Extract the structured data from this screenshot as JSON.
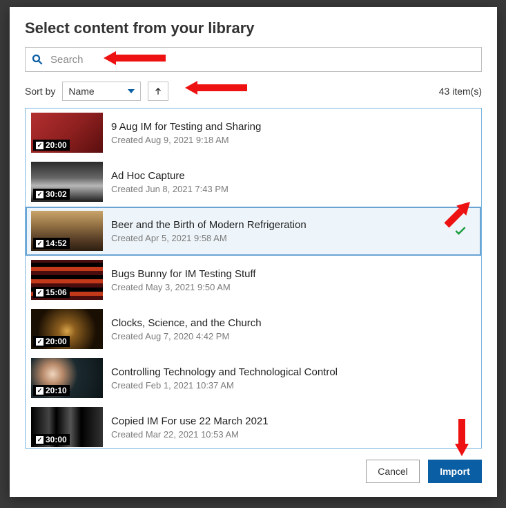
{
  "dialog": {
    "title": "Select content from your library",
    "search_placeholder": "Search",
    "sort_label": "Sort by",
    "sort_value": "Name",
    "item_count": "43 item(s)",
    "cancel_label": "Cancel",
    "import_label": "Import"
  },
  "items": [
    {
      "title": "9 Aug IM for Testing and Sharing",
      "subtitle": "Created Aug 9, 2021 9:18 AM",
      "duration": "20:00",
      "selected": false,
      "thumb_css": "linear-gradient(135deg,#b42f2f 0%,#8c1f1f 55%,#5a0e0e 100%)"
    },
    {
      "title": "Ad Hoc Capture",
      "subtitle": "Created Jun 8, 2021 7:43 PM",
      "duration": "30:02",
      "selected": false,
      "thumb_css": "linear-gradient(180deg,#2b2b2b 0%,#666 40%,#b7b7b7 60%,#1e1e1e 100%)"
    },
    {
      "title": "Beer and the Birth of Modern Refrigeration",
      "subtitle": "Created Apr 5, 2021 9:58 AM",
      "duration": "14:52",
      "selected": true,
      "thumb_css": "linear-gradient(180deg,#c9a46b 0%,#9d7a4a 30%,#5a4027 70%,#2c1e10 100%)"
    },
    {
      "title": "Bugs Bunny for IM Testing Stuff",
      "subtitle": "Created May 3, 2021 9:50 AM",
      "duration": "15:06",
      "selected": false,
      "thumb_css": "repeating-linear-gradient(0deg,#4a0d0d 0 6px,#c4391a 6px 12px,#000 12px 18px)"
    },
    {
      "title": "Clocks, Science, and the Church",
      "subtitle": "Created Aug 7, 2020 4:42 PM",
      "duration": "20:00",
      "selected": false,
      "thumb_css": "radial-gradient(circle at 50% 55%,#d9a64b 0%,#8c5e1e 20%,#1a0f03 70%)"
    },
    {
      "title": "Controlling Technology and Technological Control",
      "subtitle": "Created Feb 1, 2021 10:37 AM",
      "duration": "20:10",
      "selected": false,
      "thumb_css": "radial-gradient(circle at 30% 40%,#f0d5be 0%,#b88a6a 18%,#1b2a2f 45%,#0c1518 100%)"
    },
    {
      "title": "Copied IM For use 22 March 2021",
      "subtitle": "Created Mar 22, 2021 10:53 AM",
      "duration": "30:00",
      "selected": false,
      "thumb_css": "linear-gradient(90deg,#000 0%,#444 25%,#000 35%,#555 55%,#000 70%,#333 100%)"
    }
  ]
}
